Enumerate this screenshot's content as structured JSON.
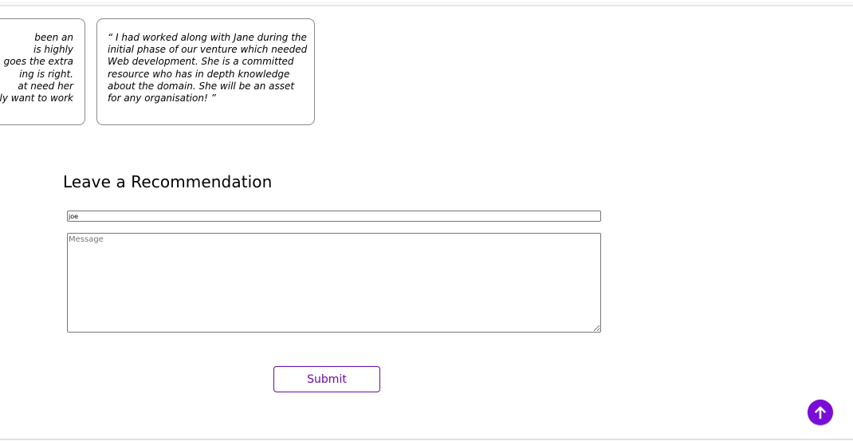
{
  "testimonials": [
    {
      "lines": [
        "been an",
        "is highly",
        "goes the extra",
        "ing is right.",
        "at need her",
        "ly want to work"
      ]
    },
    {
      "quote": "“ I had worked along with Jane during the initial phase of our venture which needed Web development. She is a committed resource who has in depth knowledge about the domain. She will be an asset for any organisation! ”"
    }
  ],
  "recommendation_form": {
    "title": "Leave a Recommendation",
    "name_value": "joe",
    "message_placeholder": "Message",
    "submit_label": "Submit"
  },
  "colors": {
    "accent": "#7b0cd8",
    "button_text": "#6a0aa8",
    "border": "#8a8a8a"
  },
  "icons": {
    "back_to_top": "arrow-up-icon"
  }
}
